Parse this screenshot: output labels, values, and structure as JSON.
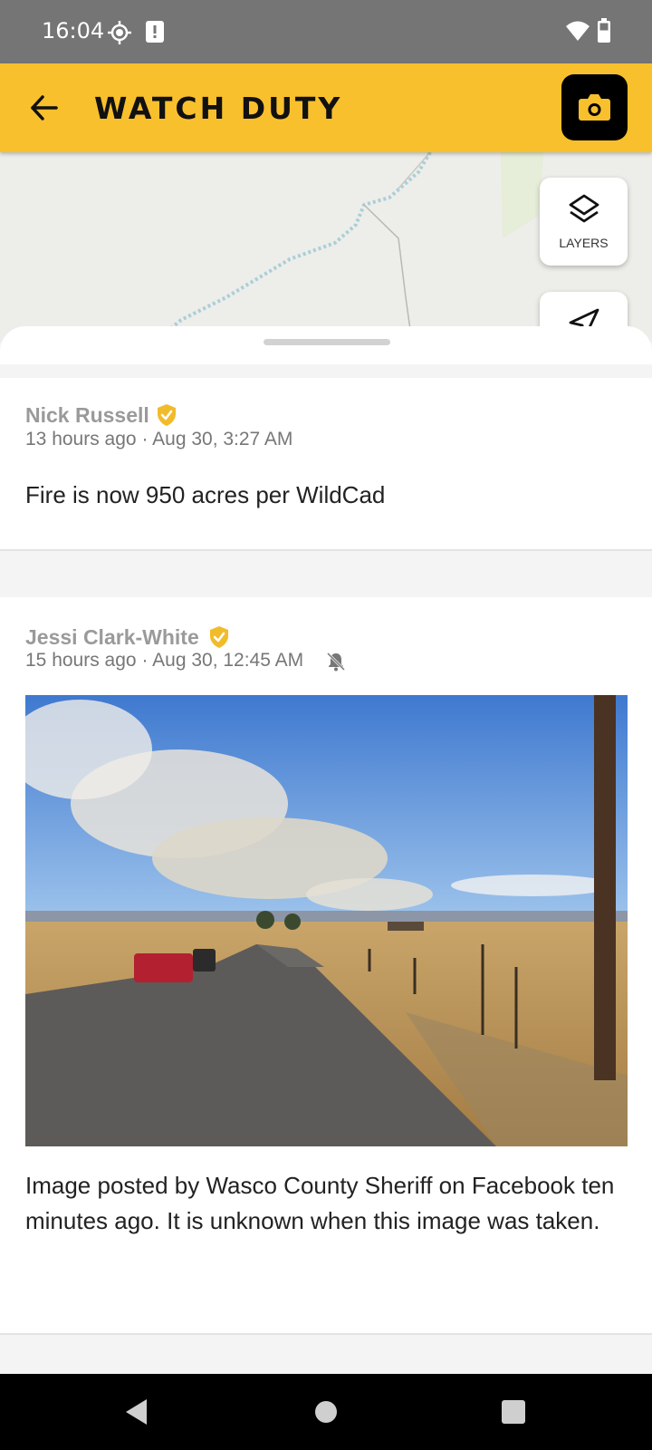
{
  "status_bar": {
    "time": "16:04",
    "icons": [
      "location-icon",
      "alert-icon",
      "wifi-icon",
      "battery-icon"
    ]
  },
  "app_bar": {
    "title": "WATCH DUTY",
    "accent_color": "#f9c02d",
    "icons": [
      "back-arrow-icon",
      "camera-icon"
    ]
  },
  "map": {
    "layers_label": "LAYERS",
    "icons": [
      "layers-icon",
      "navigate-icon"
    ]
  },
  "posts": [
    {
      "author": "Nick Russell",
      "time_ago": "13 hours ago",
      "separator": "·",
      "timestamp": "Aug 30, 3:27 AM",
      "body": "Fire is now 950 acres per WildCad"
    },
    {
      "author": "Jessi Clark-White",
      "time_ago": "15 hours ago",
      "separator": "·",
      "timestamp": "Aug 30, 12:45 AM",
      "has_photo": true,
      "body": "Image posted by Wasco County Sheriff on Facebook ten minutes ago. It is unknown when this image was taken."
    }
  ],
  "colors": {
    "verified_badge": "#f1bc2c",
    "status_bar": "#757575"
  }
}
